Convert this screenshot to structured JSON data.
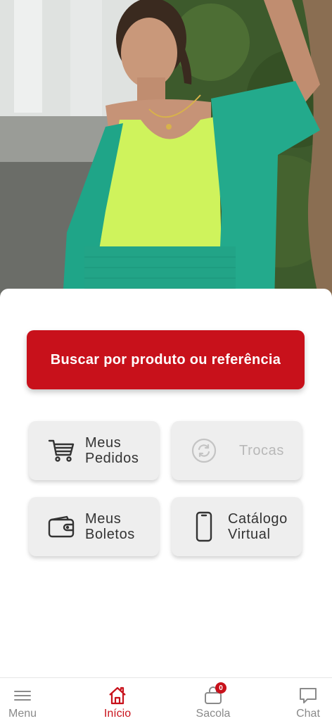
{
  "search": {
    "label": "Buscar por produto ou referência"
  },
  "tiles": [
    {
      "id": "pedidos",
      "label": "Meus\nPedidos",
      "icon": "cart-icon",
      "enabled": true
    },
    {
      "id": "trocas",
      "label": "Trocas",
      "icon": "exchange-icon",
      "enabled": false
    },
    {
      "id": "boletos",
      "label": "Meus\nBoletos",
      "icon": "wallet-icon",
      "enabled": true
    },
    {
      "id": "catalogo",
      "label": "Catálogo\nVirtual",
      "icon": "smartphone-icon",
      "enabled": true
    }
  ],
  "bottom_nav": {
    "items": [
      {
        "label": "Menu",
        "icon": "hamburger-menu-icon",
        "active": false
      },
      {
        "label": "Início",
        "icon": "home-icon",
        "active": true
      },
      {
        "label": "Sacola",
        "icon": "shopping-bag-icon",
        "active": false,
        "badge": "0"
      },
      {
        "label": "Chat",
        "icon": "chat-bubble-icon",
        "active": false
      }
    ]
  },
  "colors": {
    "brand": "#c8111b",
    "tile_bg": "#eeeeee",
    "nav_inactive": "#8a8a8a"
  }
}
